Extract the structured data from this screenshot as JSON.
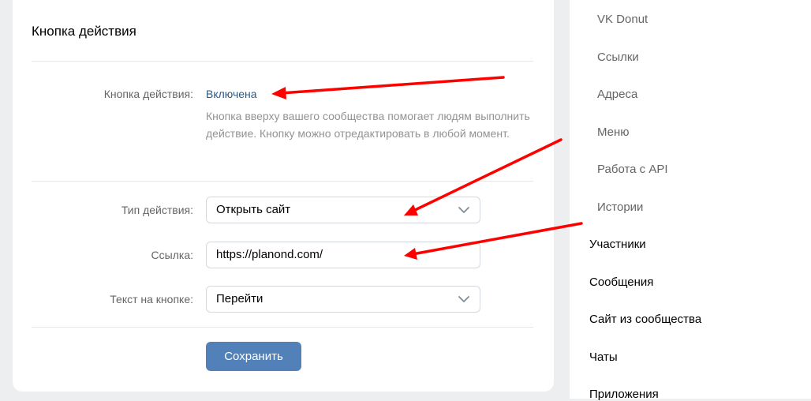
{
  "card": {
    "title": "Кнопка действия",
    "status_label": "Кнопка действия:",
    "status_value": "Включена",
    "hint": "Кнопка вверху вашего сообщества помогает людям выполнить действие. Кнопку можно отредактировать в любой момент.",
    "action_type_label": "Тип действия:",
    "action_type_value": "Открыть сайт",
    "link_label": "Ссылка:",
    "link_value": "https://planond.com/",
    "button_text_label": "Текст на кнопке:",
    "button_text_value": "Перейти",
    "save_label": "Сохранить"
  },
  "sidebar": {
    "items": [
      {
        "label": "VK Donut",
        "level": "sub"
      },
      {
        "label": "Ссылки",
        "level": "sub"
      },
      {
        "label": "Адреса",
        "level": "sub"
      },
      {
        "label": "Меню",
        "level": "sub"
      },
      {
        "label": "Работа с API",
        "level": "sub"
      },
      {
        "label": "Истории",
        "level": "sub"
      },
      {
        "label": "Участники",
        "level": "main"
      },
      {
        "label": "Сообщения",
        "level": "main"
      },
      {
        "label": "Сайт из сообщества",
        "level": "main"
      },
      {
        "label": "Чаты",
        "level": "main"
      },
      {
        "label": "Приложения",
        "level": "main"
      }
    ]
  },
  "colors": {
    "accent": "#5181b8",
    "link": "#2a5885",
    "annotation_arrow": "#ff0000",
    "background": "#edeef0"
  },
  "icons": {
    "dropdown": "chevron-down-icon"
  }
}
